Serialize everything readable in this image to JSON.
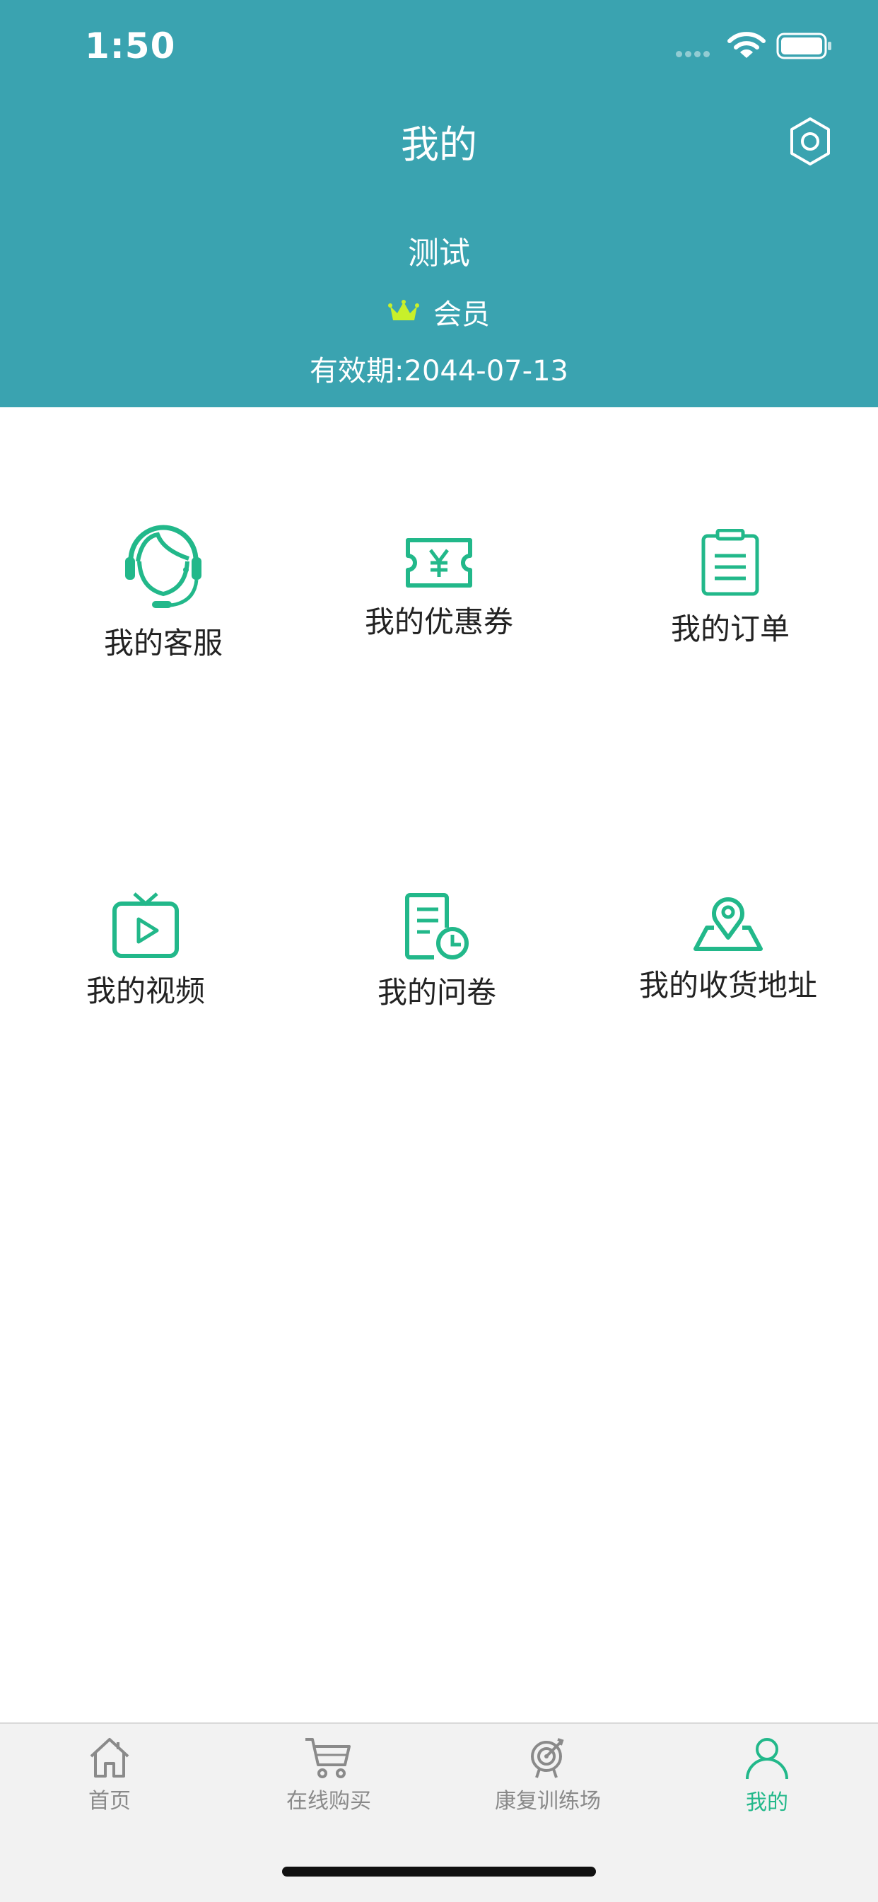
{
  "status_bar": {
    "time": "1:50"
  },
  "header": {
    "title": "我的",
    "username": "测试",
    "member_label": "会员",
    "validity": "有效期:2044-07-13"
  },
  "icons": {
    "settings": "gear-icon",
    "crown": "crown-icon",
    "customer_service": "headset-agent-icon",
    "coupon": "yen-ticket-icon",
    "orders": "clipboard-icon",
    "videos": "tv-play-icon",
    "questionnaire": "document-clock-icon",
    "address": "map-pin-icon",
    "home": "house-icon",
    "cart": "cart-icon",
    "training": "target-icon",
    "profile": "person-icon"
  },
  "menu": {
    "customer_service": "我的客服",
    "coupons": "我的优惠券",
    "orders": "我的订单",
    "videos": "我的视频",
    "questionnaire": "我的问卷",
    "address": "我的收货地址"
  },
  "tabs": {
    "home": "首页",
    "shop": "在线购买",
    "training": "康复训练场",
    "mine": "我的"
  },
  "colors": {
    "header_bg": "#3aa3b0",
    "accent_green": "#22b88a",
    "crown": "#c8f02a",
    "tab_inactive": "#8a8a8a"
  }
}
